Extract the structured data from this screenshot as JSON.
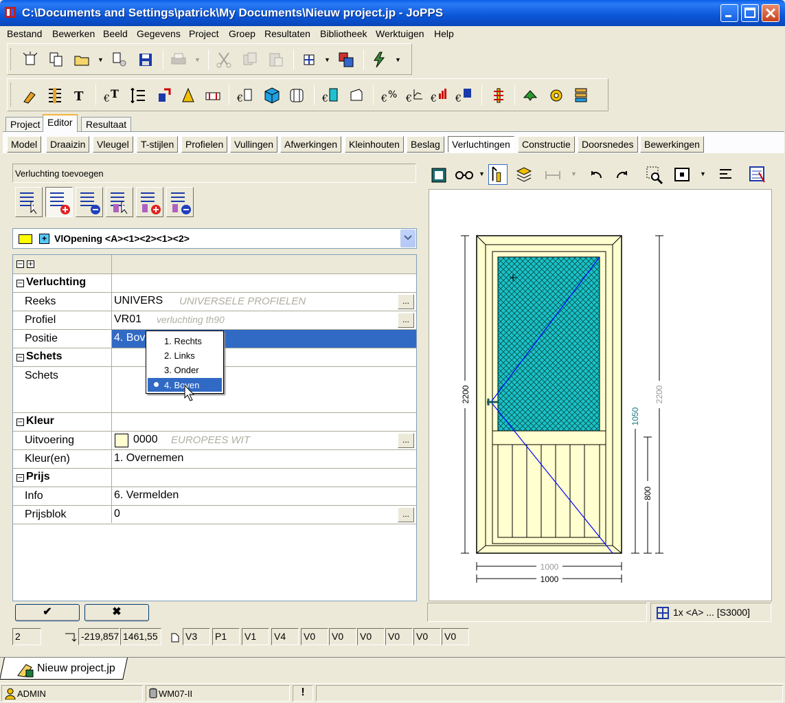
{
  "window": {
    "title": "C:\\Documents and Settings\\patrick\\My Documents\\Nieuw project.jp - JoPPS"
  },
  "menu": [
    "Bestand",
    "Bewerken",
    "Beeld",
    "Gegevens",
    "Project",
    "Groep",
    "Resultaten",
    "Bibliotheek",
    "Werktuigen",
    "Help"
  ],
  "main_tabs": [
    "Project",
    "Editor",
    "Resultaat"
  ],
  "active_main_tab": "Editor",
  "sub_tabs": [
    "Model",
    "Draaizin",
    "Vleugel",
    "T-stijlen",
    "Profielen",
    "Vullingen",
    "Afwerkingen",
    "Kleinhouten",
    "Beslag",
    "Verluchtingen",
    "Constructie",
    "Doorsnedes",
    "Bewerkingen"
  ],
  "active_sub_tab": "Verluchtingen",
  "panel": {
    "header": "Verluchting toevoegen",
    "opening": "VlOpening <A><1><2><1><2>"
  },
  "grid": {
    "rows": {
      "cat_verluchting": "Verluchting",
      "reeks_label": "Reeks",
      "reeks_value": "UNIVERS",
      "reeks_desc": "UNIVERSELE PROFIELEN",
      "profiel_label": "Profiel",
      "profiel_value": "VR01",
      "profiel_desc": "verluchting th90",
      "positie_label": "Positie",
      "positie_value": "4. Boven",
      "cat_schets": "Schets",
      "schets_label": "Schets",
      "cat_kleur": "Kleur",
      "uitvoering_label": "Uitvoering",
      "uitvoering_value": "0000",
      "uitvoering_desc": "EUROPEES WIT",
      "kleuren_label": "Kleur(en)",
      "kleuren_value": "1. Overnemen",
      "cat_prijs": "Prijs",
      "info_label": "Info",
      "info_value": "6. Vermelden",
      "prijsblok_label": "Prijsblok",
      "prijsblok_value": "0"
    },
    "ellipsis": "..."
  },
  "popup": {
    "options": [
      "1. Rechts",
      "2. Links",
      "3. Onder",
      "4. Boven"
    ],
    "selected": "4. Boven"
  },
  "buttons": {
    "ok": "✔",
    "cancel": "✖"
  },
  "status_fields": {
    "count": "2",
    "x": "-219,857",
    "y": "1461,55",
    "codes": [
      "V3",
      "P1",
      "V1",
      "V4",
      "V0",
      "V0",
      "V0",
      "V0",
      "V0",
      "V0"
    ]
  },
  "drawing": {
    "dim_total_height": "2200",
    "dim_total_height_outer": "2200",
    "dim_glass": "1050",
    "dim_panel": "800",
    "dim_width_outer": "1000",
    "dim_width": "1000",
    "colors": {
      "frame_fill": "#ffffd0",
      "glass_fill": "#19c3c8",
      "line": "#0000ff"
    }
  },
  "right_status": {
    "text": "1x <A> ... [S3000]"
  },
  "doc_tab": {
    "label": "Nieuw project.jp"
  },
  "statusbar": {
    "user": "ADMIN",
    "db": "WM07-II",
    "alert": "!"
  }
}
